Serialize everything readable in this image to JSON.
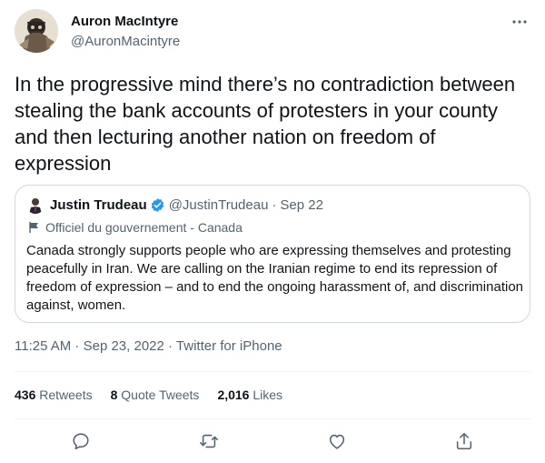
{
  "author": {
    "name": "Auron MacIntyre",
    "handle": "@AuronMacintyre"
  },
  "tweet": {
    "text": "In the progressive mind there’s no contradiction between stealing the bank accounts of protesters in your county and then lecturing another nation on freedom of expression"
  },
  "quote": {
    "name": "Justin Trudeau",
    "handle": "@JustinTrudeau",
    "separator": "·",
    "date": "Sep 22",
    "label": "Officiel du gouvernement - Canada",
    "text": "Canada strongly supports people who are expressing themselves and protesting peacefully in Iran. We are calling on the Iranian regime to end its repression of freedom of expression – and to end the ongoing harassment of, and discrimination against, women."
  },
  "meta": {
    "time": "11:25 AM",
    "sep1": " · ",
    "date": "Sep 23, 2022",
    "sep2": " · ",
    "source": "Twitter for iPhone"
  },
  "stats": {
    "retweets_count": "436",
    "retweets_label": "Retweets",
    "quotes_count": "8",
    "quotes_label": "Quote Tweets",
    "likes_count": "2,016",
    "likes_label": "Likes"
  },
  "icons": {
    "verified": "verified-badge-icon",
    "flag": "government-flag-icon",
    "reply": "reply-icon",
    "retweet": "retweet-icon",
    "like": "heart-icon",
    "share": "share-icon",
    "more": "more-options-icon"
  },
  "colors": {
    "text": "#0f1419",
    "secondary": "#536471",
    "border": "#cfd9de",
    "verified": "#1d9bf0"
  }
}
